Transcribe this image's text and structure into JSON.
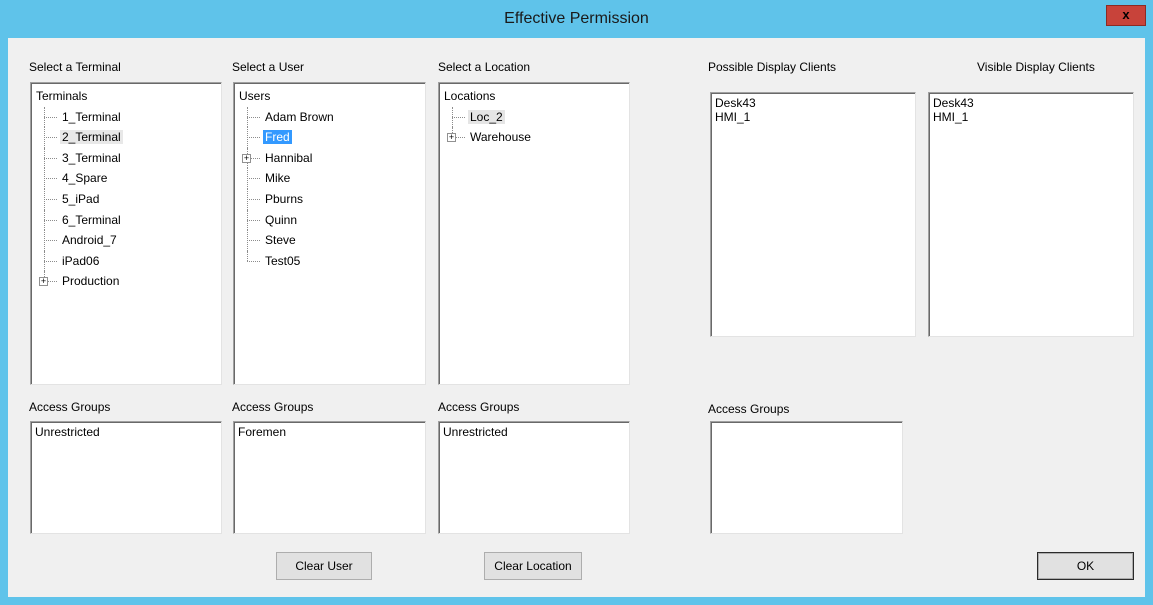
{
  "window": {
    "title": "Effective Permission",
    "close_label": "x"
  },
  "terminal": {
    "label": "Select a Terminal",
    "root": "Terminals",
    "items": [
      "1_Terminal",
      "2_Terminal",
      "3_Terminal",
      "4_Spare",
      "5_iPad",
      "6_Terminal",
      "Android_7",
      "iPad06",
      "Production"
    ],
    "access_label": "Access Groups",
    "access_items": [
      "Unrestricted"
    ]
  },
  "user": {
    "label": "Select a User",
    "root": "Users",
    "items": [
      "Adam Brown",
      "Fred",
      "Hannibal",
      "Mike",
      "Pburns",
      "Quinn",
      "Steve",
      "Test05"
    ],
    "access_label": "Access Groups",
    "access_items": [
      "Foremen"
    ]
  },
  "location": {
    "label": "Select a Location",
    "root": "Locations",
    "items": [
      "Loc_2",
      "Warehouse"
    ],
    "access_label": "Access Groups",
    "access_items": [
      "Unrestricted"
    ]
  },
  "possible": {
    "label": "Possible Display Clients",
    "items": [
      "Desk43",
      "HMI_1"
    ],
    "access_label": "Access Groups"
  },
  "visible": {
    "label": "Visible Display Clients",
    "items": [
      "Desk43",
      "HMI_1"
    ]
  },
  "buttons": {
    "clear_user": "Clear User",
    "clear_location": "Clear Location",
    "ok": "OK"
  },
  "icons": {
    "expand": "+"
  }
}
